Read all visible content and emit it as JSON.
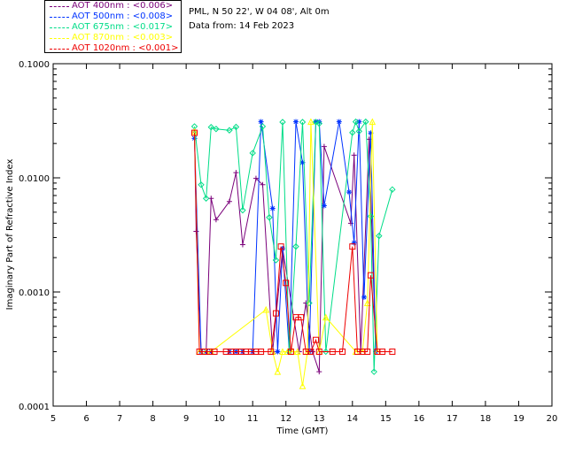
{
  "legend": [
    {
      "label": "AOT  400nm : <0.006>",
      "color": "#7a007a"
    },
    {
      "label": "AOT  500nm : <0.008>",
      "color": "#0033ff"
    },
    {
      "label": "AOT  675nm : <0.017>",
      "color": "#00dd88"
    },
    {
      "label": "AOT  870nm : <0.003>",
      "color": "#ffff00"
    },
    {
      "label": "AOT 1020nm : <0.001>",
      "color": "#ee0000"
    }
  ],
  "info": {
    "site": "PML, N 50 22', W 04 08', Alt 0m",
    "date": "Data from: 14 Feb 2023"
  },
  "chart_data": {
    "type": "line",
    "xlabel": "Time (GMT)",
    "ylabel": "Imaginary Part of Refractive Index",
    "xlim": [
      5,
      20
    ],
    "ylim": [
      0.0001,
      0.1
    ],
    "yscale": "log",
    "xticks": [
      "5",
      "6",
      "7",
      "8",
      "9",
      "10",
      "11",
      "12",
      "13",
      "14",
      "15",
      "16",
      "17",
      "18",
      "19",
      "20"
    ],
    "yticks": [
      "0.0001",
      "0.0010",
      "0.0100",
      "0.1000"
    ],
    "series": [
      {
        "name": "AOT  400nm : <0.006>",
        "color": "#7a007a",
        "marker": "plus",
        "x": [
          9.25,
          9.3,
          9.45,
          9.6,
          9.75,
          9.9,
          10.3,
          10.5,
          10.7,
          11.1,
          11.3,
          11.6,
          11.9,
          12.4,
          12.6,
          12.8,
          13.0,
          13.15,
          13.95,
          14.05,
          14.25,
          14.5,
          14.7
        ],
        "y": [
          0.0252,
          0.0034,
          0.0003,
          0.0003,
          0.0066,
          0.0043,
          0.0062,
          0.0111,
          0.0026,
          0.0099,
          0.0087,
          0.0003,
          0.0024,
          0.0003,
          0.0008,
          0.0003,
          0.0002,
          0.0188,
          0.004,
          0.0158,
          0.0003,
          0.0218,
          0.0003
        ]
      },
      {
        "name": "AOT  500nm : <0.008>",
        "color": "#0033ff",
        "marker": "star",
        "x": [
          9.25,
          9.45,
          9.6,
          9.75,
          10.3,
          10.5,
          10.7,
          11.0,
          11.25,
          11.6,
          11.75,
          11.9,
          12.1,
          12.3,
          12.5,
          12.7,
          12.9,
          13.0,
          13.15,
          13.6,
          13.9,
          14.05,
          14.2,
          14.35,
          14.55,
          14.7
        ],
        "y": [
          0.0222,
          0.0003,
          0.0003,
          0.0003,
          0.0003,
          0.0003,
          0.0003,
          0.0003,
          0.031,
          0.0054,
          0.0003,
          0.0024,
          0.0003,
          0.031,
          0.0136,
          0.0003,
          0.031,
          0.031,
          0.0057,
          0.031,
          0.0075,
          0.0027,
          0.031,
          0.0009,
          0.0247,
          0.0003
        ]
      },
      {
        "name": "AOT  675nm : <0.017>",
        "color": "#00dd88",
        "marker": "diamond",
        "x": [
          9.25,
          9.45,
          9.6,
          9.75,
          9.9,
          10.3,
          10.5,
          10.7,
          11.0,
          11.3,
          11.5,
          11.7,
          11.9,
          12.1,
          12.3,
          12.5,
          12.7,
          12.9,
          13.0,
          13.2,
          14.0,
          14.1,
          14.2,
          14.4,
          14.55,
          14.65,
          14.8,
          15.2
        ],
        "y": [
          0.0282,
          0.0087,
          0.0066,
          0.0278,
          0.0268,
          0.0261,
          0.0279,
          0.0052,
          0.0165,
          0.0282,
          0.0045,
          0.0019,
          0.0308,
          0.0003,
          0.0025,
          0.0308,
          0.0008,
          0.0308,
          0.0299,
          0.0003,
          0.0249,
          0.031,
          0.0256,
          0.031,
          0.0046,
          0.0002,
          0.0031,
          0.0079
        ]
      },
      {
        "name": "AOT  870nm : <0.003>",
        "color": "#ffff00",
        "marker": "triangle",
        "x": [
          9.25,
          9.4,
          9.6,
          9.75,
          11.4,
          11.6,
          11.75,
          11.9,
          12.05,
          12.2,
          12.35,
          12.5,
          12.65,
          12.75,
          13.0,
          13.2,
          14.1,
          14.3,
          14.45,
          14.6,
          14.75
        ],
        "y": [
          0.0255,
          0.0003,
          0.0003,
          0.0003,
          0.0007,
          0.0003,
          0.0002,
          0.0003,
          0.0003,
          0.0003,
          0.0003,
          0.00015,
          0.0003,
          0.031,
          0.0003,
          0.0006,
          0.0003,
          0.0003,
          0.0008,
          0.031,
          0.0003
        ]
      },
      {
        "name": "AOT 1020nm : <0.001>",
        "color": "#ee0000",
        "marker": "square",
        "x": [
          9.25,
          9.4,
          9.55,
          9.7,
          9.85,
          10.2,
          10.35,
          10.5,
          10.65,
          10.8,
          10.95,
          11.1,
          11.25,
          11.55,
          11.7,
          11.85,
          12.0,
          12.15,
          12.3,
          12.45,
          12.6,
          12.75,
          12.9,
          13.0,
          13.4,
          13.7,
          14.0,
          14.15,
          14.3,
          14.45,
          14.55,
          14.75,
          14.9,
          15.2
        ],
        "y": [
          0.0248,
          0.0003,
          0.0003,
          0.0003,
          0.0003,
          0.0003,
          0.0003,
          0.0003,
          0.0003,
          0.0003,
          0.0003,
          0.0003,
          0.0003,
          0.0003,
          0.00065,
          0.0025,
          0.0012,
          0.0003,
          0.0006,
          0.0006,
          0.0003,
          0.0003,
          0.00038,
          0.0003,
          0.0003,
          0.0003,
          0.0025,
          0.0003,
          0.0003,
          0.0003,
          0.0014,
          0.0003,
          0.0003,
          0.0003
        ]
      }
    ],
    "grid": false,
    "legend_position": "top-left, outside plot"
  }
}
